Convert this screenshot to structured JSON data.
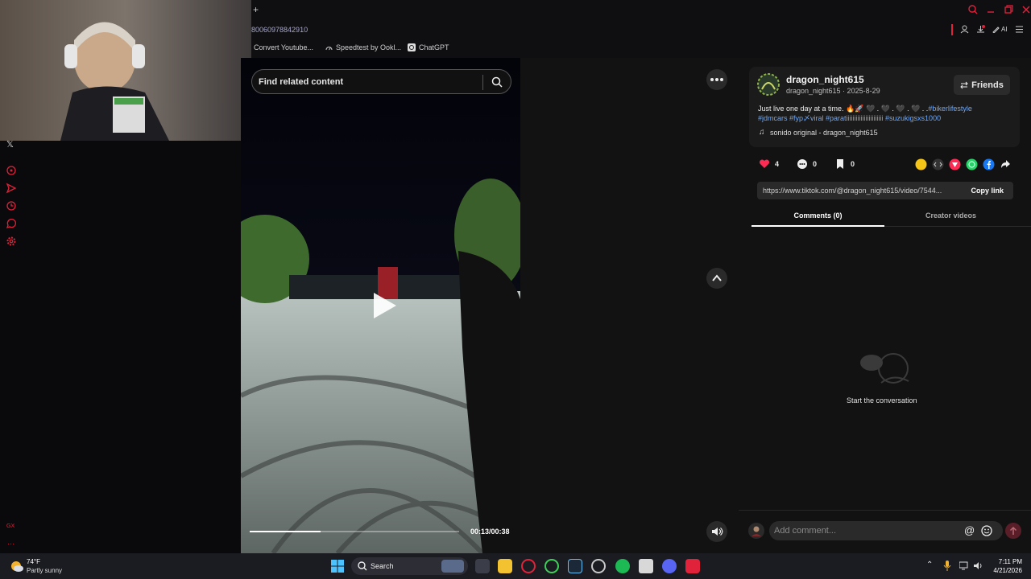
{
  "browser": {
    "new_tab": "+",
    "url_fragment": "80060978842910",
    "ai_label": "AI",
    "bookmarks": [
      "Convert Youtube...",
      "Speedtest by Ookl...",
      "ChatGPT"
    ]
  },
  "video": {
    "search_placeholder": "Find related content",
    "time": "00:13/00:38",
    "progress": 0.34
  },
  "post": {
    "username": "dragon_night615",
    "handle_date": "dragon_night615 · 2025-8-29",
    "friends_label": "Friends",
    "caption_line1": "Just live one day at a time. 🔥🚀 🖤 . 🖤 . 🖤 . 🖤 . .",
    "caption_tag1": "#bikerlifestyle",
    "caption_line2": "#jdmcars #fyp〆viral #paratiiiiiiiiiiiiiiiiiiiiiii #suzukigsxs1000",
    "sound": "sonido original - dragon_night615",
    "likes": "4",
    "comments": "0",
    "saves": "0",
    "url": "https://www.tiktok.com/@dragon_night615/video/7544...",
    "copy_link": "Copy link",
    "tab_comments": "Comments (0)",
    "tab_creator": "Creator videos",
    "empty_text": "Start the conversation",
    "add_comment": "Add comment..."
  },
  "taskbar": {
    "temp": "74°F",
    "weather": "Partly sunny",
    "search": "Search",
    "time": "7:11 PM",
    "date": "4/21/2026"
  },
  "colors": {
    "accent": "#fe2c55",
    "link": "#6aa8ff",
    "opera": "#e0223a"
  }
}
